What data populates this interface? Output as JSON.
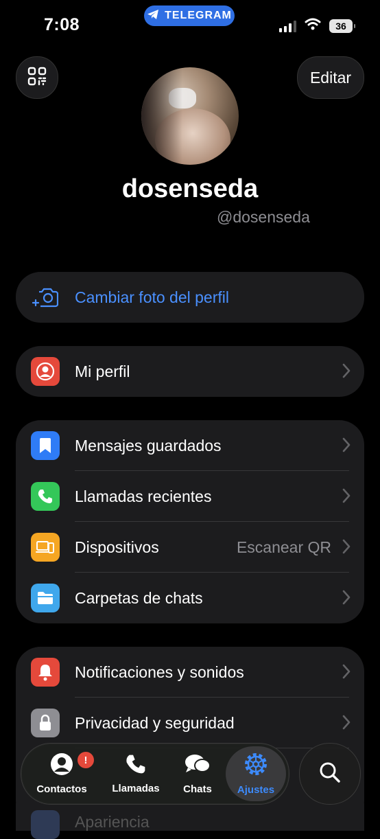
{
  "status": {
    "time": "7:08",
    "app_pill": "TELEGRAM",
    "battery": "36"
  },
  "header": {
    "edit_label": "Editar"
  },
  "profile": {
    "name": "dosenseda",
    "username": "@dosenseda"
  },
  "change_photo": {
    "label": "Cambiar foto del perfil"
  },
  "my_profile": {
    "label": "Mi perfil"
  },
  "group1": [
    {
      "label": "Mensajes guardados",
      "icon": "bookmark-icon",
      "color": "#2f7cf6"
    },
    {
      "label": "Llamadas recientes",
      "icon": "phone-icon",
      "color": "#34c759"
    },
    {
      "label": "Dispositivos",
      "value": "Escanear QR",
      "icon": "devices-icon",
      "color": "#f5a623"
    },
    {
      "label": "Carpetas de chats",
      "icon": "folder-icon",
      "color": "#3fa7ec"
    }
  ],
  "group2": [
    {
      "label": "Notificaciones y sonidos",
      "icon": "bell-icon",
      "color": "#e5493b"
    },
    {
      "label": "Privacidad y seguridad",
      "icon": "lock-icon",
      "color": "#8e8e93"
    }
  ],
  "peek": {
    "label": "Apariencia"
  },
  "tabbar": {
    "contacts": "Contactos",
    "calls": "Llamadas",
    "chats": "Chats",
    "settings": "Ajustes",
    "contacts_badge": "!",
    "active_color": "#3d8bfd"
  }
}
